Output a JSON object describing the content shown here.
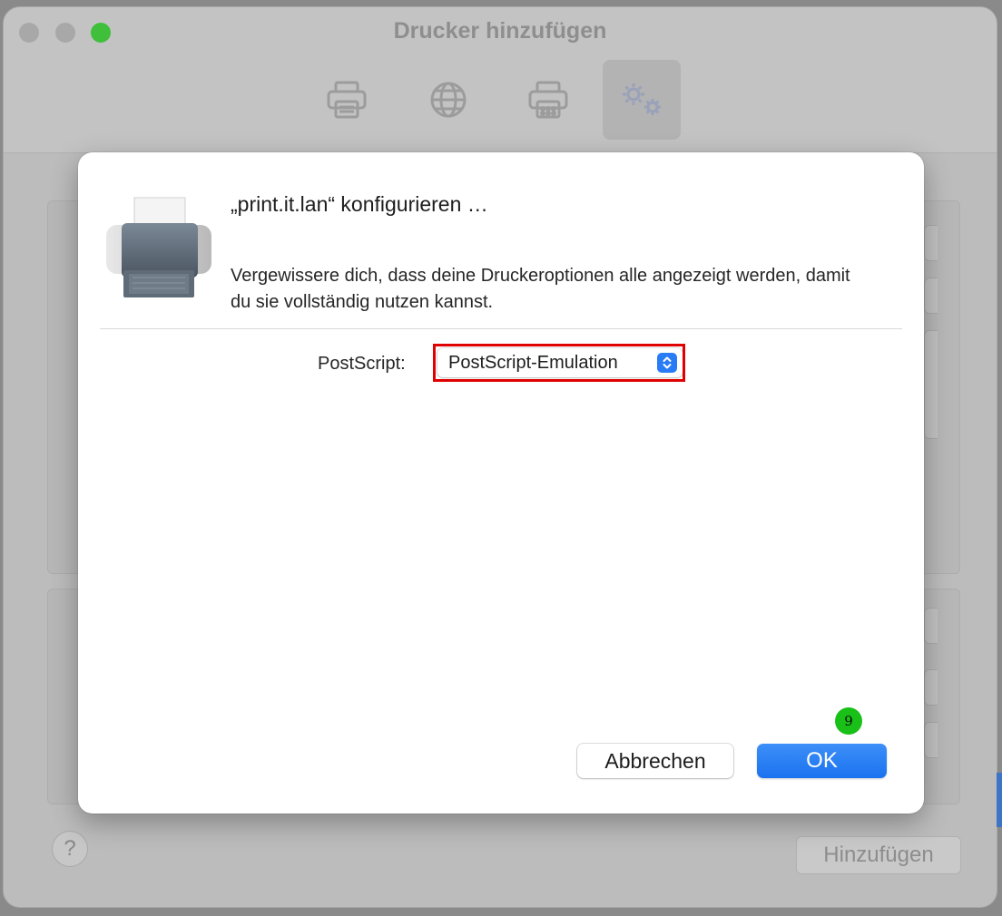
{
  "window": {
    "title": "Drucker hinzufügen",
    "toolbar": [
      {
        "icon": "printer-icon"
      },
      {
        "icon": "globe-icon"
      },
      {
        "icon": "fax-printer-icon"
      },
      {
        "icon": "gears-icon",
        "active": true
      }
    ],
    "help_label": "?",
    "add_label": "Hinzufügen"
  },
  "dialog": {
    "title": "„print.it.lan“ konfigurieren …",
    "description": "Vergewissere dich, dass deine Druckeroptionen alle angezeigt werden, damit du sie vollständig nutzen kannst.",
    "postscript_label": "PostScript:",
    "postscript_value": "PostScript-Emulation",
    "cancel_label": "Abbrechen",
    "ok_label": "OK",
    "step_badge": "9"
  },
  "colors": {
    "accent": "#2a7cf6",
    "highlight": "#e00000",
    "badge": "#18c018"
  }
}
